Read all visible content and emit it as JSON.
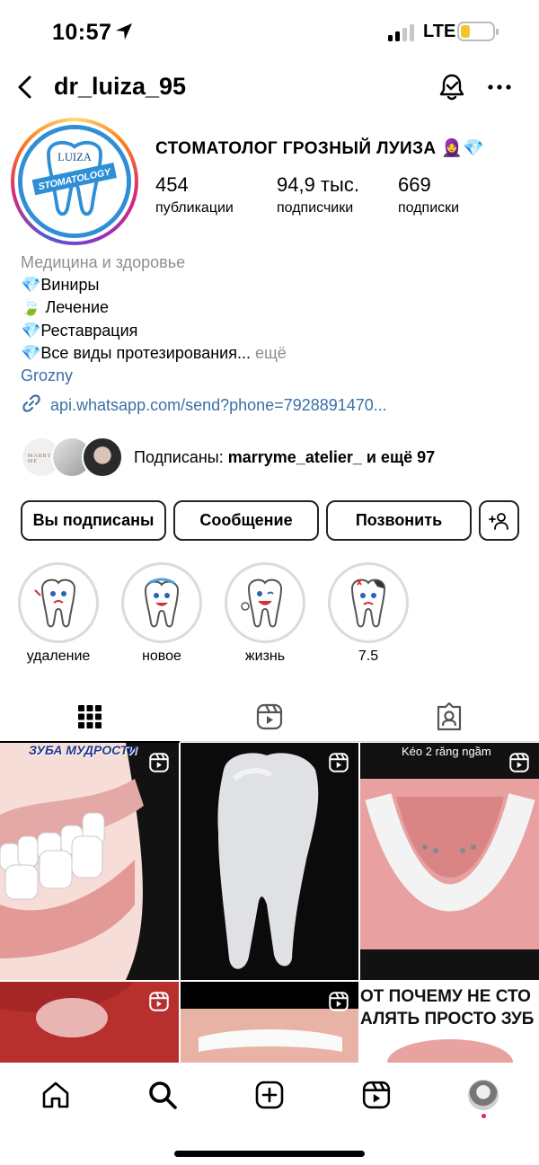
{
  "status_bar": {
    "time": "10:57",
    "network": "LTE"
  },
  "header": {
    "username": "dr_luiza_95"
  },
  "avatar": {
    "text_top": "LUIZA",
    "text_band": "STOMATOLOGY"
  },
  "profile": {
    "full_name": "СТОМАТОЛОГ ГРОЗНЫЙ ЛУИЗА 🧕💎",
    "stats": [
      {
        "value": "454",
        "label": "публикации"
      },
      {
        "value": "94,9 тыс.",
        "label": "подписчики"
      },
      {
        "value": "669",
        "label": "подписки"
      }
    ],
    "category": "Медицина и здоровье",
    "bio_lines": [
      {
        "emoji": "💎",
        "text": "Виниры"
      },
      {
        "emoji": "🍃",
        "text": "Лечение"
      },
      {
        "emoji": "💎",
        "text": "Реставрация"
      },
      {
        "emoji": "💎",
        "text": "Все виды протезирования... "
      }
    ],
    "bio_more": "ещё",
    "location": "Grozny",
    "link": "api.whatsapp.com/send?phone=7928891470...",
    "followed_by_prefix": "Подписаны: ",
    "followed_by_user": "marryme_atelier_",
    "followed_by_suffix": " и ещё 97",
    "mini_avatar_text": "MARRY ME"
  },
  "buttons": {
    "following": "Вы подписаны",
    "message": "Сообщение",
    "call": "Позвонить"
  },
  "highlights": [
    {
      "label": "удаление"
    },
    {
      "label": "новое"
    },
    {
      "label": "жизнь"
    },
    {
      "label": "7.5"
    }
  ],
  "grid": {
    "post1_caption": "ЗУБА МУДРОСТИ",
    "post3_caption": "Kéo 2 răng ngầm",
    "post6_caption_1": "ОТ ПОЧЕМУ НЕ СТО",
    "post6_caption_2": "АЛЯТЬ ПРОСТО ЗУБ"
  },
  "colors": {
    "link": "#3a6fa8",
    "muted": "#8e8e8e",
    "battery": "#f4c430",
    "notification_dot": "#e0245e"
  }
}
